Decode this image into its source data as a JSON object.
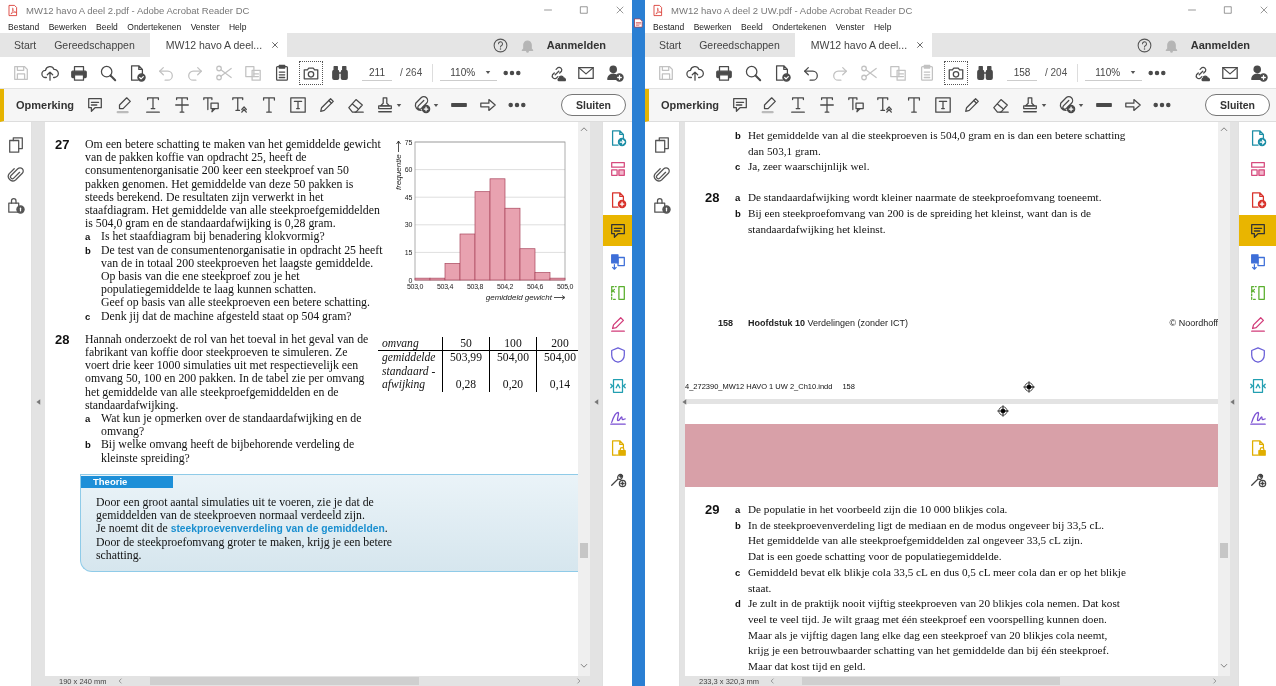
{
  "windows": [
    {
      "title": "MW12 havo A deel 2.pdf - Adobe Acrobat Reader DC",
      "menu": [
        "Bestand",
        "Bewerken",
        "Beeld",
        "Ondertekenen",
        "Venster",
        "Help"
      ],
      "tabs": [
        {
          "label": "Start",
          "selected": false
        },
        {
          "label": "Gereedschappen",
          "selected": false
        },
        {
          "label": "MW12 havo A deel...",
          "selected": true
        }
      ],
      "sign_in": "Aanmelden",
      "toolbar": {
        "tools": [
          {
            "kind": "save",
            "disabled": true,
            "selected": false
          },
          {
            "kind": "upload",
            "disabled": false,
            "selected": false
          },
          {
            "kind": "print",
            "disabled": false,
            "selected": false
          },
          {
            "kind": "search",
            "disabled": false,
            "selected": false
          },
          {
            "kind": "export",
            "disabled": false,
            "selected": false
          },
          {
            "kind": "undo",
            "disabled": true,
            "selected": false
          },
          {
            "kind": "redo",
            "disabled": true,
            "selected": false
          },
          {
            "kind": "cut",
            "disabled": true,
            "selected": false
          },
          {
            "kind": "copy",
            "disabled": true,
            "selected": false
          },
          {
            "kind": "clipboard",
            "disabled": false,
            "selected": false
          },
          {
            "kind": "snapshot",
            "disabled": false,
            "selected": true
          },
          {
            "kind": "find",
            "disabled": false,
            "selected": false
          }
        ],
        "page": "211",
        "page_count": "/ 264",
        "zoom": "110%"
      },
      "comment_bar": {
        "label": "Opmerking",
        "close": "Sluiten"
      },
      "tools_panel": [
        {
          "kind": "create",
          "selected": false
        },
        {
          "kind": "organize",
          "selected": false
        },
        {
          "kind": "export",
          "selected": false
        },
        {
          "kind": "comment",
          "selected": true
        },
        {
          "kind": "combine",
          "selected": false
        },
        {
          "kind": "compress",
          "selected": false
        },
        {
          "kind": "fill_sign",
          "selected": false
        },
        {
          "kind": "protect",
          "selected": false
        },
        {
          "kind": "convert",
          "selected": false
        },
        {
          "kind": "sign",
          "selected": false
        },
        {
          "kind": "file_lock",
          "selected": false
        },
        {
          "kind": "more_tools",
          "selected": false
        }
      ],
      "document": {
        "kind": "exercises",
        "exercises": [
          {
            "number": "27",
            "text": "Om een betere schatting te maken van het gemiddelde gewicht van de pakken koffie van opdracht 25, heeft de consumentenorganisatie 200 keer een steekproef van 50 pakken genomen. Het gemiddelde van deze 50 pakken is steeds berekend. De resultaten zijn verwerkt in het staafdiagram. Het gemiddelde van alle steekproefgemiddelden is 504,0 gram en de standaardafwijking is 0,28 gram.",
            "parts": [
              {
                "letter": "a",
                "paragraphs": [
                  "Is het staafdiagram bij benadering klokvormig?"
                ]
              },
              {
                "letter": "b",
                "paragraphs": [
                  "De test van de consumentenorganisatie in opdracht 25 heeft van de in totaal 200 steekproeven het laagste gemiddelde. Op basis van die ene steekproef zou je het populatiegemiddelde te laag kunnen schatten.",
                  "Geef op basis van alle steekproeven een betere schatting."
                ]
              },
              {
                "letter": "c",
                "paragraphs": [
                  "Denk jij dat de machine afgesteld staat op 504 gram?"
                ]
              }
            ],
            "chart_data": {
              "type": "bar",
              "xlabel": "gemiddeld gewicht",
              "ylabel": "frequentie",
              "grid": true,
              "x": [
                503.1,
                503.3,
                503.5,
                503.7,
                503.9,
                504.1,
                504.3,
                504.5,
                504.7,
                504.9
              ],
              "values": [
                1,
                1,
                9,
                25,
                48,
                55,
                39,
                17,
                4,
                1
              ],
              "xlim": [
                503.0,
                505.0
              ],
              "ylim": [
                0,
                75
              ],
              "xticks": [
                {
                  "value": 503.0,
                  "label": "503,0"
                },
                {
                  "value": 503.4,
                  "label": "503,4"
                },
                {
                  "value": 503.8,
                  "label": "503,8"
                },
                {
                  "value": 504.2,
                  "label": "504,2"
                },
                {
                  "value": 504.6,
                  "label": "504,6"
                },
                {
                  "value": 505.0,
                  "label": "505,0"
                }
              ],
              "yticks": [
                0,
                15,
                30,
                45,
                60,
                75
              ]
            }
          },
          {
            "number": "28",
            "text": "Hannah onderzoekt de rol van het toeval in het geval van de fabrikant van koffie door steekproeven te simuleren. Ze voert drie keer 1000 simulaties uit met respectievelijk een omvang 50, 100 en 200 pakken. In de tabel zie per omvang het gemiddelde van alle steekproefgemiddelden en de standaardafwijking.",
            "parts": [
              {
                "letter": "a",
                "paragraphs": [
                  "Wat kun je opmerken over de standaardafwijking en de omvang?"
                ]
              },
              {
                "letter": "b",
                "paragraphs": [
                  "Bij welke omvang heeft de bijbehorende verdeling de kleinste spreiding?"
                ]
              }
            ],
            "table": {
              "columns": [
                "omvang",
                "50",
                "100",
                "200"
              ],
              "rows": [
                [
                  "gemiddelde",
                  "503,99",
                  "504,00",
                  "504,00"
                ],
                [
                  "standaard -\nafwijking",
                  "0,28",
                  "0,20",
                  "0,14"
                ]
              ]
            }
          }
        ],
        "theory": {
          "title": "Theorie",
          "paragraphs": [
            "Door een groot aantal simulaties uit te voeren, zie je dat de gemiddelden van de steekproeven normaal verdeeld zijn.",
            "Je noemt dit de **steekproevenverdeling van de gemiddelden**.",
            "Door de steekproefomvang groter te maken, krijg je een betere schatting."
          ]
        }
      },
      "page_size": "190 x 240 mm"
    },
    {
      "title": "MW12 havo A deel 2 UW.pdf - Adobe Acrobat Reader DC",
      "menu": [
        "Bestand",
        "Bewerken",
        "Beeld",
        "Ondertekenen",
        "Venster",
        "Help"
      ],
      "tabs": [
        {
          "label": "Start",
          "selected": false
        },
        {
          "label": "Gereedschappen",
          "selected": false
        },
        {
          "label": "MW12 havo A deel...",
          "selected": true
        }
      ],
      "sign_in": "Aanmelden",
      "toolbar": {
        "tools": [
          {
            "kind": "save",
            "disabled": true,
            "selected": false
          },
          {
            "kind": "upload",
            "disabled": false,
            "selected": false
          },
          {
            "kind": "print",
            "disabled": false,
            "selected": false
          },
          {
            "kind": "search",
            "disabled": false,
            "selected": false
          },
          {
            "kind": "export",
            "disabled": false,
            "selected": false
          },
          {
            "kind": "undo",
            "disabled": false,
            "selected": false
          },
          {
            "kind": "redo",
            "disabled": true,
            "selected": false
          },
          {
            "kind": "cut",
            "disabled": true,
            "selected": false
          },
          {
            "kind": "copy",
            "disabled": true,
            "selected": false
          },
          {
            "kind": "clipboard",
            "disabled": true,
            "selected": false
          },
          {
            "kind": "snapshot",
            "disabled": false,
            "selected": true
          },
          {
            "kind": "find",
            "disabled": false,
            "selected": false
          }
        ],
        "page": "158",
        "page_count": "/ 204",
        "zoom": "110%"
      },
      "comment_bar": {
        "label": "Opmerking",
        "close": "Sluiten"
      },
      "tools_panel": [
        {
          "kind": "create",
          "selected": false
        },
        {
          "kind": "organize",
          "selected": false
        },
        {
          "kind": "export",
          "selected": false
        },
        {
          "kind": "comment",
          "selected": true
        },
        {
          "kind": "combine",
          "selected": false
        },
        {
          "kind": "compress",
          "selected": false
        },
        {
          "kind": "fill_sign",
          "selected": false
        },
        {
          "kind": "protect",
          "selected": false
        },
        {
          "kind": "convert",
          "selected": false
        },
        {
          "kind": "sign",
          "selected": false
        },
        {
          "kind": "file_lock",
          "selected": false
        },
        {
          "kind": "more_tools",
          "selected": false
        }
      ],
      "document": {
        "kind": "answers",
        "answers": [
          {
            "parts": [
              {
                "letter": "b",
                "paragraphs": [
                  "Het gemiddelde van al die steekproeven is 504,0 gram en is dan een betere schatting dan 503,1 gram."
                ]
              },
              {
                "letter": "c",
                "paragraphs": [
                  "Ja, zeer waarschijnlijk wel."
                ]
              }
            ]
          },
          {
            "number": "28",
            "parts": [
              {
                "letter": "a",
                "paragraphs": [
                  "De standaardafwijking wordt kleiner naarmate de steekproefomvang toeneemt."
                ]
              },
              {
                "letter": "b",
                "paragraphs": [
                  "Bij een steekproefomvang van 200 is de spreiding het kleinst, want dan is de standaardafwijking het kleinst."
                ]
              }
            ]
          }
        ],
        "footer": {
          "page": "158",
          "title": "**Hoofdstuk 10** Verdelingen (zonder ICT)",
          "copyright": "© Noordhoff"
        },
        "slug": {
          "file": "4_272390_MW12 HAVO 1 UW 2_Ch10.indd",
          "page": "158"
        },
        "next_page": {
          "answers": [
            {
              "number": "29",
              "parts": [
                {
                  "letter": "a",
                  "paragraphs": [
                    "De populatie in het voorbeeld zijn die 10 000 blikjes cola."
                  ]
                },
                {
                  "letter": "b",
                  "paragraphs": [
                    "In de steekproevenverdeling ligt de mediaan en de modus ongeveer bij 33,5 cL.",
                    "Het gemiddelde van alle steekproefgemiddelden zal ongeveer 33,5 cL zijn.",
                    "Dat is een goede schatting voor de populatiegemiddelde."
                  ]
                },
                {
                  "letter": "c",
                  "paragraphs": [
                    "Gemiddeld bevat elk blikje cola 33,5 cL en dus 0,5 cL meer cola dan er op het blikje staat."
                  ]
                },
                {
                  "letter": "d",
                  "paragraphs": [
                    "Je zult in de praktijk nooit vijftig steekproeven van 20 blikjes cola nemen. Dat kost veel te veel tijd. Je wilt graag met één steekproef een voorspelling kunnen doen. Maar als je vijftig dagen lang elke dag een steekproef van 20 blikjes cola neemt, krijg je een betrouwbaarder schatting van het gemiddelde dan bij één steekproef. Maar dat kost tijd en geld."
                  ]
                }
              ]
            }
          ]
        }
      },
      "page_size": "233,3 x 320,3 mm"
    }
  ]
}
